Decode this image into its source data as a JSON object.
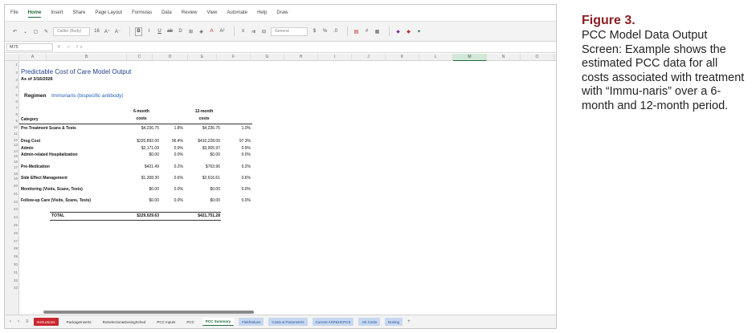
{
  "menu": {
    "tabs": [
      "File",
      "Home",
      "Insert",
      "Share",
      "Page Layout",
      "Formulas",
      "Data",
      "Review",
      "View",
      "Automate",
      "Help",
      "Draw"
    ],
    "active_tab": "Home"
  },
  "ribbon": {
    "font_name": "Calibri (Body)",
    "font_size": "16",
    "number_format": "General"
  },
  "formula_bar": {
    "name_box": "M75",
    "icons": "✕ ✓ fx",
    "formula": ""
  },
  "grid": {
    "columns": [
      "A",
      "B",
      "C",
      "D",
      "E",
      "F",
      "G",
      "H",
      "I",
      "J",
      "K",
      "L",
      "M",
      "N",
      "O"
    ],
    "selected_column": "M",
    "row_numbers": [
      "1",
      "2",
      "3",
      "4",
      "5",
      "6",
      "7",
      "8",
      "9",
      "10",
      "11",
      "12",
      "13",
      "14",
      "15",
      "16",
      "17",
      "18",
      "19",
      "20",
      "21",
      "22",
      "23",
      "24",
      "25",
      "26",
      "27",
      "28",
      "29",
      "30",
      "31",
      "32",
      "33"
    ]
  },
  "sheet": {
    "title": "Predictable Cost of Care Model Output",
    "as_of": "As of 3/16/2026",
    "regimen_label": "Regimen",
    "regimen_name": "Immunaris (bispecific antibody)",
    "col_category": "Category",
    "col_6m_line1": "6-month",
    "col_6m_line2": "costs",
    "col_12m_line1": "12-month",
    "col_12m_line2": "costs",
    "rows": [
      {
        "row": "7",
        "category": "Pre-Treatment Scans & Tests",
        "c6": "$4,236.75",
        "p6": "1.8%",
        "c12": "$4,236.75",
        "p12": "1.0%"
      },
      {
        "row": "9",
        "category": "Drug Cost",
        "c6": "$220,892.00",
        "p6": "96.4%",
        "c12": "$410,228.00",
        "p12": "97.3%"
      },
      {
        "row": "10",
        "category": "Admin",
        "c6": "$2,171.09",
        "p6": "0.9%",
        "c12": "$3,905.97",
        "p12": "0.9%"
      },
      {
        "row": "11",
        "category": "Admin-related Hospitalization",
        "c6": "$0.00",
        "p6": "0.0%",
        "c12": "$0.00",
        "p12": "0.0%"
      },
      {
        "row": "13",
        "category": "Pre-Medication",
        "c6": "$421.49",
        "p6": "0.2%",
        "c12": "$763.96",
        "p12": "0.2%"
      },
      {
        "row": "15",
        "category": "Side Effect Management",
        "c6": "$1,308.30",
        "p6": "0.6%",
        "c12": "$2,616.61",
        "p12": "0.6%"
      },
      {
        "row": "17",
        "category": "Monitoring (Visits, Scans, Tests)",
        "c6": "$0.00",
        "p6": "0.0%",
        "c12": "$0.00",
        "p12": "0.0%"
      },
      {
        "row": "19",
        "category": "Follow-up Care (Visits, Scans, Tests)",
        "c6": "$0.00",
        "p6": "0.0%",
        "c12": "$0.00",
        "p12": "0.0%"
      }
    ],
    "total_label": "TOTAL",
    "total_6m": "$229,029.63",
    "total_12m": "$421,751.28"
  },
  "sheet_tabs": [
    {
      "label": "Instructions",
      "style": "red"
    },
    {
      "label": "PackageInserts",
      "style": "plain"
    },
    {
      "label": "RxSelection&DosingSched",
      "style": "plain"
    },
    {
      "label": "PCC Inputs",
      "style": "plain"
    },
    {
      "label": "PCC",
      "style": "plain"
    },
    {
      "label": "PCC Summary",
      "style": "active"
    },
    {
      "label": "FieldValues",
      "style": "blue"
    },
    {
      "label": "Costs & Parameters",
      "style": "blue"
    },
    {
      "label": "Current ASP&HCPCS",
      "style": "blue"
    },
    {
      "label": "AE Costs",
      "style": "blue"
    },
    {
      "label": "Dosing",
      "style": "blue"
    }
  ],
  "caption": {
    "label": "Figure 3.",
    "text": "PCC Model Data Output Screen: Example shows the estimated PCC data for all costs associated with treatment with “Immu-naris” over a 6-month and 12-month period."
  },
  "colors": {
    "excel_green": "#1f6b3a",
    "title_blue": "#1f3f8a",
    "caption_red": "#8b1e22",
    "tab_red": "#c8282e",
    "tab_blue": "#c7d8f0"
  }
}
